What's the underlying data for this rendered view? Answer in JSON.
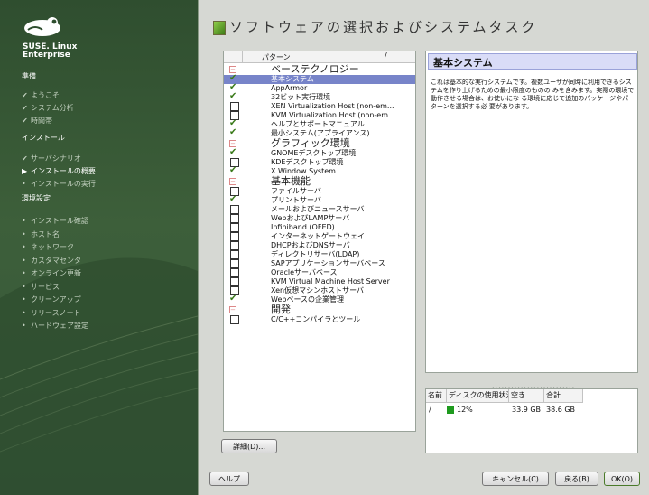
{
  "brand": {
    "line1": "SUSE. Linux",
    "line2": "Enterprise"
  },
  "sidebar": {
    "steps": [
      {
        "label": "準備",
        "state": "header"
      },
      {
        "label": "ようこそ",
        "state": "done"
      },
      {
        "label": "システム分析",
        "state": "done"
      },
      {
        "label": "時間帯",
        "state": "done"
      },
      {
        "label": "インストール",
        "state": "header"
      },
      {
        "label": "サーバシナリオ",
        "state": "done"
      },
      {
        "label": "インストールの概要",
        "state": "current"
      },
      {
        "label": "インストールの実行",
        "state": "todo"
      },
      {
        "label": "環境設定",
        "state": "header"
      },
      {
        "label": "インストール確認",
        "state": "todo"
      },
      {
        "label": "ホスト名",
        "state": "todo"
      },
      {
        "label": "ネットワーク",
        "state": "todo"
      },
      {
        "label": "カスタマセンタ",
        "state": "todo"
      },
      {
        "label": "オンライン更新",
        "state": "todo"
      },
      {
        "label": "サービス",
        "state": "todo"
      },
      {
        "label": "クリーンアップ",
        "state": "todo"
      },
      {
        "label": "リリースノート",
        "state": "todo"
      },
      {
        "label": "ハードウェア設定",
        "state": "todo"
      }
    ]
  },
  "page_title": "ソフトウェアの選択およびシステムタスク",
  "patterns": {
    "header_label": "パターン",
    "header_sort": "/",
    "rows": [
      {
        "type": "group",
        "label": "ベーステクノロジー"
      },
      {
        "type": "item",
        "label": "基本システム",
        "checked": true,
        "selected": true
      },
      {
        "type": "item",
        "label": "AppArmor",
        "checked": true
      },
      {
        "type": "item",
        "label": "32ビット実行環境",
        "checked": true
      },
      {
        "type": "item",
        "label": "XEN Virtualization Host (non-em...",
        "checked": false
      },
      {
        "type": "item",
        "label": "KVM Virtualization Host (non-em...",
        "checked": false
      },
      {
        "type": "item",
        "label": "ヘルプとサポートマニュアル",
        "checked": true
      },
      {
        "type": "item",
        "label": "最小システム(アプライアンス)",
        "checked": true
      },
      {
        "type": "group",
        "label": "グラフィック環境"
      },
      {
        "type": "item",
        "label": "GNOMEデスクトップ環境",
        "checked": true
      },
      {
        "type": "item",
        "label": "KDEデスクトップ環境",
        "checked": false
      },
      {
        "type": "item",
        "label": "X Window System",
        "checked": true
      },
      {
        "type": "group",
        "label": "基本機能"
      },
      {
        "type": "item",
        "label": "ファイルサーバ",
        "checked": false
      },
      {
        "type": "item",
        "label": "プリントサーバ",
        "checked": true
      },
      {
        "type": "item",
        "label": "メールおよびニュースサーバ",
        "checked": false
      },
      {
        "type": "item",
        "label": "WebおよびLAMPサーバ",
        "checked": false
      },
      {
        "type": "item",
        "label": "Infiniband (OFED)",
        "checked": false
      },
      {
        "type": "item",
        "label": "インターネットゲートウェイ",
        "checked": false
      },
      {
        "type": "item",
        "label": "DHCPおよびDNSサーバ",
        "checked": false
      },
      {
        "type": "item",
        "label": "ディレクトリサーバ(LDAP)",
        "checked": false
      },
      {
        "type": "item",
        "label": "SAPアプリケーションサーバベース",
        "checked": false
      },
      {
        "type": "item",
        "label": "Oracleサーバベース",
        "checked": false
      },
      {
        "type": "item",
        "label": "KVM Virtual Machine Host Server",
        "checked": false
      },
      {
        "type": "item",
        "label": "Xen仮想マシンホストサーバ",
        "checked": false
      },
      {
        "type": "item",
        "label": "Webベースの企業管理",
        "checked": true
      },
      {
        "type": "group",
        "label": "開発"
      },
      {
        "type": "item",
        "label": "C/C++コンパイラとツール",
        "checked": false
      }
    ]
  },
  "description": {
    "title": "基本システム",
    "text": "これは基本的な実行システムです。複数ユーザが同時に利用できるシステムを作り上げるための最小限度のものの みを含みます。実際の環境で動作させる場合は、お使いにな る環境に応じて追加のパッケージやパターンを選択する必 要があります。"
  },
  "disk": {
    "headers": [
      "名前",
      "ディスクの使用状況",
      "空き",
      "合計"
    ],
    "row": {
      "name": "/",
      "usage": "12%",
      "free": "33.9 GB",
      "total": "38.6 GB"
    },
    "usage_fraction": 0.12
  },
  "buttons": {
    "details": "詳細(D)...",
    "help": "ヘルプ",
    "cancel": "キャンセル(C)",
    "back": "戻る(B)",
    "ok": "OK(O)"
  }
}
